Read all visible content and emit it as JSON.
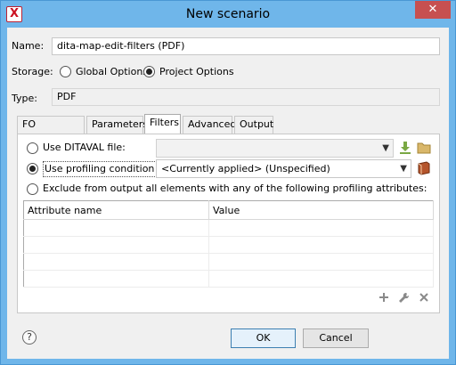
{
  "window": {
    "title": "New scenario",
    "close_glyph": "✕",
    "app_icon_glyph": "X"
  },
  "name": {
    "label": "Name:",
    "value": "dita-map-edit-filters (PDF)"
  },
  "storage": {
    "label": "Storage:",
    "global_label": "Global Options",
    "project_label": "Project Options",
    "selected": "project"
  },
  "type": {
    "label": "Type:",
    "value": "PDF"
  },
  "tabs": [
    {
      "label": "FO Processor"
    },
    {
      "label": "Parameters"
    },
    {
      "label": "Filters",
      "active": true
    },
    {
      "label": "Advanced"
    },
    {
      "label": "Output"
    }
  ],
  "filters": {
    "ditaval_label": "Use DITAVAL file:",
    "ditaval_value": "",
    "profiling_label": "Use profiling condition set",
    "profiling_value": "<Currently applied> (Unspecified)",
    "exclude_label": "Exclude from output all elements with any of the following profiling attributes:",
    "selected": "profiling"
  },
  "table": {
    "columns": [
      "Attribute name",
      "Value"
    ],
    "rows": 4
  },
  "buttons": {
    "ok": "OK",
    "cancel": "Cancel",
    "help": "?"
  },
  "icons": {
    "download": "download-icon",
    "folder": "folder-icon",
    "book": "book-icon",
    "add": "add-icon",
    "edit": "wrench-icon",
    "remove": "remove-icon"
  },
  "colors": {
    "titlebar": "#6fb6ea",
    "close": "#c75050",
    "accent": "#3c7fb1"
  }
}
